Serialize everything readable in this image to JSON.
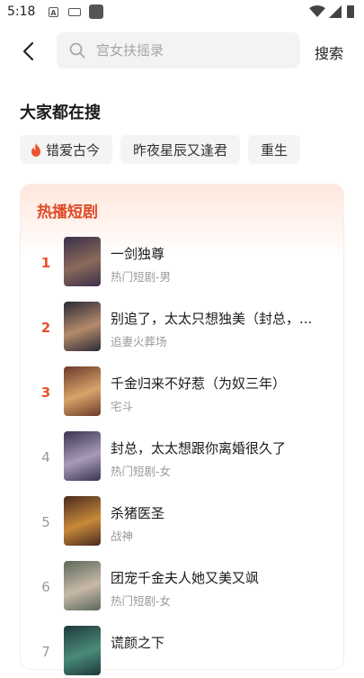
{
  "status_bar": {
    "time": "5:18"
  },
  "header": {
    "search_placeholder": "宫女扶摇录",
    "search_button": "搜索"
  },
  "hot_search": {
    "title": "大家都在搜",
    "chips": [
      "错爱古今",
      "昨夜星辰又逢君",
      "重生"
    ]
  },
  "ranking": {
    "title": "热播短剧",
    "items": [
      {
        "rank": "1",
        "title": "一剑独尊",
        "tag": "热门短剧-男",
        "cover_colors": [
          "#3a2f4a",
          "#8a6a5a"
        ]
      },
      {
        "rank": "2",
        "title": "别追了，太太只想独美（封总，...",
        "tag": "追妻火葬场",
        "cover_colors": [
          "#2b2a38",
          "#b48a6a"
        ]
      },
      {
        "rank": "3",
        "title": "千金归来不好惹（为奴三年）",
        "tag": "宅斗",
        "cover_colors": [
          "#6b3a2a",
          "#d8a46a"
        ]
      },
      {
        "rank": "4",
        "title": "封总，太太想跟你离婚很久了",
        "tag": "热门短剧-女",
        "cover_colors": [
          "#3a3550",
          "#a89ab8"
        ]
      },
      {
        "rank": "5",
        "title": "杀猪医圣",
        "tag": "战神",
        "cover_colors": [
          "#4a2a1e",
          "#c88a3a"
        ]
      },
      {
        "rank": "6",
        "title": "团宠千金夫人她又美又飒",
        "tag": "热门短剧-女",
        "cover_colors": [
          "#5a6a5a",
          "#c8b8a8"
        ]
      },
      {
        "rank": "7",
        "title": "谎颜之下",
        "tag": "",
        "cover_colors": [
          "#1e3a3a",
          "#4a8a7a"
        ]
      }
    ]
  }
}
